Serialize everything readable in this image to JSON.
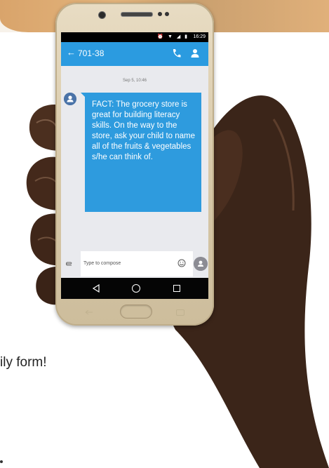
{
  "background": {
    "text": "ily form!",
    "colors": {
      "strip": "#d9a46b",
      "hand": "#3b2519"
    }
  },
  "status_bar": {
    "icons": "⏰ ▼ ◢ ▮",
    "time": "16:29"
  },
  "app_bar": {
    "back_icon": "arrow-left-icon",
    "title": "701-38",
    "call_icon": "phone-icon",
    "contact_icon": "person-icon",
    "color": "#2b9be0"
  },
  "conversation": {
    "timestamp": "Sep 5, 10:46",
    "message": "FACT: The grocery store is great for building literacy skills. On the way to the store, ask your child to name all of the fruits & vegetables s/he can think of.",
    "bubble_color": "#2e9bde"
  },
  "composer": {
    "placeholder": "Type to compose",
    "attach_icon": "paperclip-icon",
    "emoji_icon": "emoji-icon",
    "send_icon": "send-icon"
  },
  "nav_bar": {
    "back": "◁",
    "home": "○",
    "recent": "□"
  }
}
